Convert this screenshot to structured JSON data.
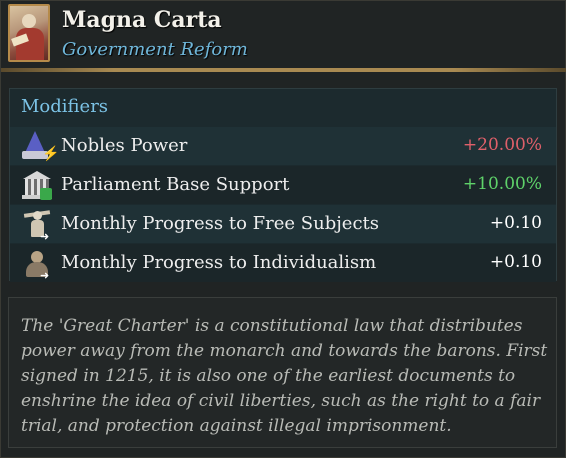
{
  "header": {
    "title": "Magna Carta",
    "subtitle": "Government Reform",
    "portrait_icon": "magna-carta-portrait"
  },
  "modifiers": {
    "heading": "Modifiers",
    "items": [
      {
        "icon": "nobles-power-icon",
        "label": "Nobles Power",
        "value": "+20.00%",
        "value_color": "#e0606a"
      },
      {
        "icon": "parliament-icon",
        "label": "Parliament Base Support",
        "value": "+10.00%",
        "value_color": "#5fd36a"
      },
      {
        "icon": "free-subjects-icon",
        "label": "Monthly Progress to Free Subjects",
        "value": "+0.10",
        "value_color": "#ffffff"
      },
      {
        "icon": "individualism-icon",
        "label": "Monthly Progress to Individualism",
        "value": "+0.10",
        "value_color": "#ffffff"
      }
    ]
  },
  "description": {
    "text": "The 'Great Charter' is a constitutional law that distributes power away from the monarch and towards the barons. First signed in 1215, it is also one of the earliest documents to enshrine the idea of civil liberties, such as the right to a fair trial, and protection against illegal imprisonment."
  },
  "colors": {
    "title": "#f3f1ea",
    "subtitle": "#6fb6d9",
    "heading": "#7cc3e6",
    "divider": "#a98a52"
  }
}
